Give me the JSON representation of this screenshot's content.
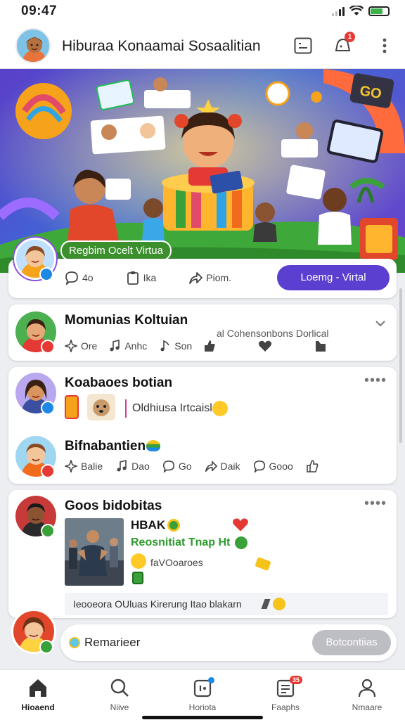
{
  "status": {
    "time": "09:47"
  },
  "header": {
    "title": "Hiburaa Konaamai Sosaalitian",
    "notif_count": "1"
  },
  "hero": {
    "label": "Regbim Ocelt Virtua"
  },
  "featured": {
    "actions": [
      {
        "icon": "comment-icon",
        "label": "4o"
      },
      {
        "icon": "clipboard-icon",
        "label": "Ika"
      },
      {
        "icon": "share-icon",
        "label": "Piom."
      }
    ],
    "cta": "Loemg - Virtal"
  },
  "post1": {
    "title": "Momunias Koltuian",
    "subtitle": "al Cohensonbons Dorlical",
    "actions": [
      {
        "icon": "sparkle-icon",
        "label": "Ore"
      },
      {
        "icon": "music-note-icon",
        "label": "Anhc"
      },
      {
        "icon": "music-note-icon",
        "label": "Son"
      }
    ]
  },
  "post2": {
    "title": "Koabaoes botian",
    "subtitle": "Oldhiusa Irtcaisl",
    "sub_title": "Bifnabantien",
    "actions": [
      {
        "icon": "sparkle-icon",
        "label": "Balie"
      },
      {
        "icon": "music-note-icon",
        "label": "Dao"
      },
      {
        "icon": "comment-icon",
        "label": "Go"
      },
      {
        "icon": "share-icon",
        "label": "Daik"
      },
      {
        "icon": "comment-icon",
        "label": "Gooo"
      }
    ]
  },
  "post3": {
    "title": "Goos bidobitas",
    "line1": "HBAK",
    "line2": "Reosnitiat Tnap Ht",
    "line3": "faVOoaroes",
    "footer": "Ieooeora OUluas  Kirerung Itao blakarn"
  },
  "compose": {
    "label": "Remarieer",
    "button": "Botcontiias"
  },
  "tabs": [
    {
      "icon": "home-icon",
      "label": "Hioaend"
    },
    {
      "icon": "search-icon",
      "label": "Niive"
    },
    {
      "icon": "notification-icon",
      "label": "Horiota"
    },
    {
      "icon": "messages-icon",
      "label": "Faaphs",
      "badge": "35"
    },
    {
      "icon": "profile-icon",
      "label": "Nmaare"
    }
  ],
  "colors": {
    "accent": "#5b3fd0",
    "green": "#3aa13a",
    "red": "#e53935",
    "blue": "#1e88e5"
  }
}
